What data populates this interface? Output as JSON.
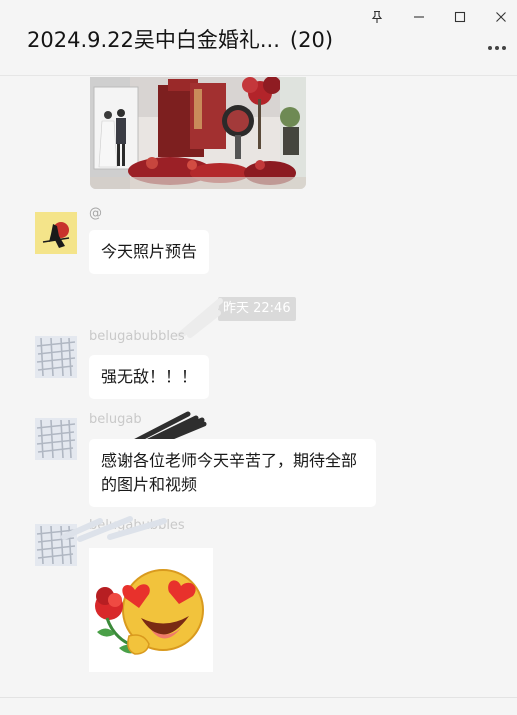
{
  "header": {
    "title": "2024.9.22吴中白金婚礼...",
    "member_count": "(20)"
  },
  "window_controls": {
    "pin_icon": "pin-icon",
    "minimize_icon": "minimize-icon",
    "maximize_icon": "maximize-icon",
    "close_icon": "close-icon",
    "more_icon": "more-dots-icon"
  },
  "messages": [
    {
      "type": "image",
      "description_icon": "wedding-photo-image"
    },
    {
      "type": "text",
      "sender": "@",
      "text": "今天照片预告"
    },
    {
      "type": "time",
      "text": "昨天 22:46"
    },
    {
      "type": "text",
      "sender": "belugabubbles",
      "text": "强无敌！！！"
    },
    {
      "type": "text",
      "sender": "belugab",
      "text": "感谢各位老师今天辛苦了，期待全部的图片和视频"
    },
    {
      "type": "sticker",
      "sender": "belugabubbles",
      "description_icon": "heart-eyes-emoji-with-roses-sticker"
    }
  ],
  "colors": {
    "background": "#f5f5f5",
    "bubble": "#ffffff",
    "time_pill": "#dadada",
    "sender_text": "#a6a6a6"
  }
}
